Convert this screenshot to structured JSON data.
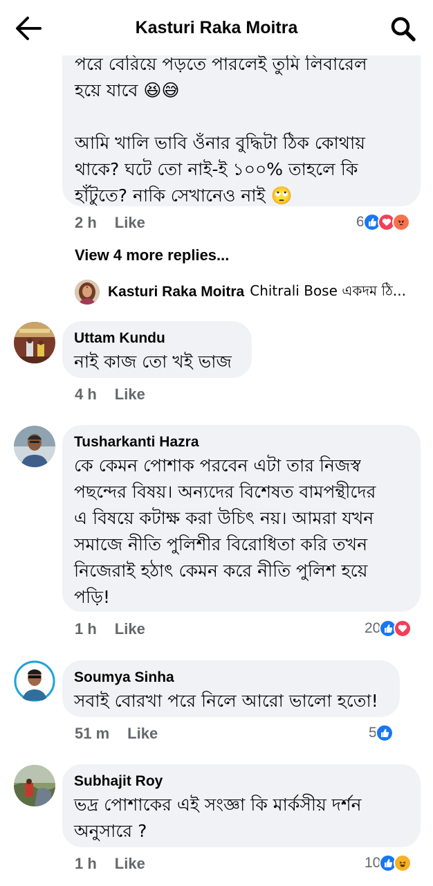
{
  "header": {
    "title": "Kasturi Raka Moitra",
    "back_icon": "arrow-left-icon",
    "search_icon": "search-icon"
  },
  "comments": [
    {
      "lines": [
        "পরে বেরিয়ে পড়তে পারলেই তুমি লিবারেল",
        "হয়ে যাবে 😆😅",
        "",
        "আমি খালি ভাবি ওঁনার বুদ্ধিটা ঠিক কোথায়",
        "থাকে? ঘটে তো নাই-ই ১০০% তাহলে কি",
        "হাঁটুতে? নাকি সেখানেও নাই 🙄"
      ],
      "time": "2 h",
      "like_label": "Like",
      "reaction_count": "6",
      "reactions": [
        "like",
        "love",
        "angry"
      ]
    },
    {
      "author": "Uttam Kundu",
      "lines": [
        "নাই কাজ তো খই ভাজ"
      ],
      "time": "4 h",
      "like_label": "Like"
    },
    {
      "author": "Tusharkanti Hazra",
      "lines": [
        "কে কেমন পোশাক পরবেন এটা তার নিজস্ব",
        "পছন্দের বিষয়। অন্যদের বিশেষত বামপন্থীদের",
        "এ বিষয়ে কটাক্ষ করা উচিৎ নয়। আমরা যখন",
        "সমাজে  নীতি পুলিশীর বিরোধিতা করি তখন",
        "নিজেরাই হঠাৎ কেমন করে নীতি পুলিশ হয়ে",
        "পড়ি!"
      ],
      "time": "1 h",
      "like_label": "Like",
      "reaction_count": "20",
      "reactions": [
        "like",
        "love"
      ]
    },
    {
      "author": "Soumya Sinha",
      "lines": [
        "সবাই বোরখা পরে নিলে আরো ভালো হতো!"
      ],
      "time": "51 m",
      "like_label": "Like",
      "reaction_count": "5",
      "reactions": [
        "like"
      ]
    },
    {
      "author": "Subhajit Roy",
      "lines": [
        "ভদ্র পোশাকের এই সংজ্ঞা কি মার্কসীয় দর্শন",
        "অনুসারে ?"
      ],
      "time": "1 h",
      "like_label": "Like",
      "reaction_count": "10",
      "reactions": [
        "like",
        "haha"
      ]
    }
  ],
  "more_replies": "View 4 more replies...",
  "reply_preview": {
    "author": "Kasturi Raka Moitra",
    "snippet": "Chitrali Bose একদম ঠি..."
  },
  "colors": {
    "like_blue": "#1877f2",
    "love_red": "#f33e58",
    "angry_orange": "#f7714c",
    "haha_yellow": "#f7b125",
    "bubble_gray": "#f0f2f5",
    "meta_gray": "#65676b"
  }
}
